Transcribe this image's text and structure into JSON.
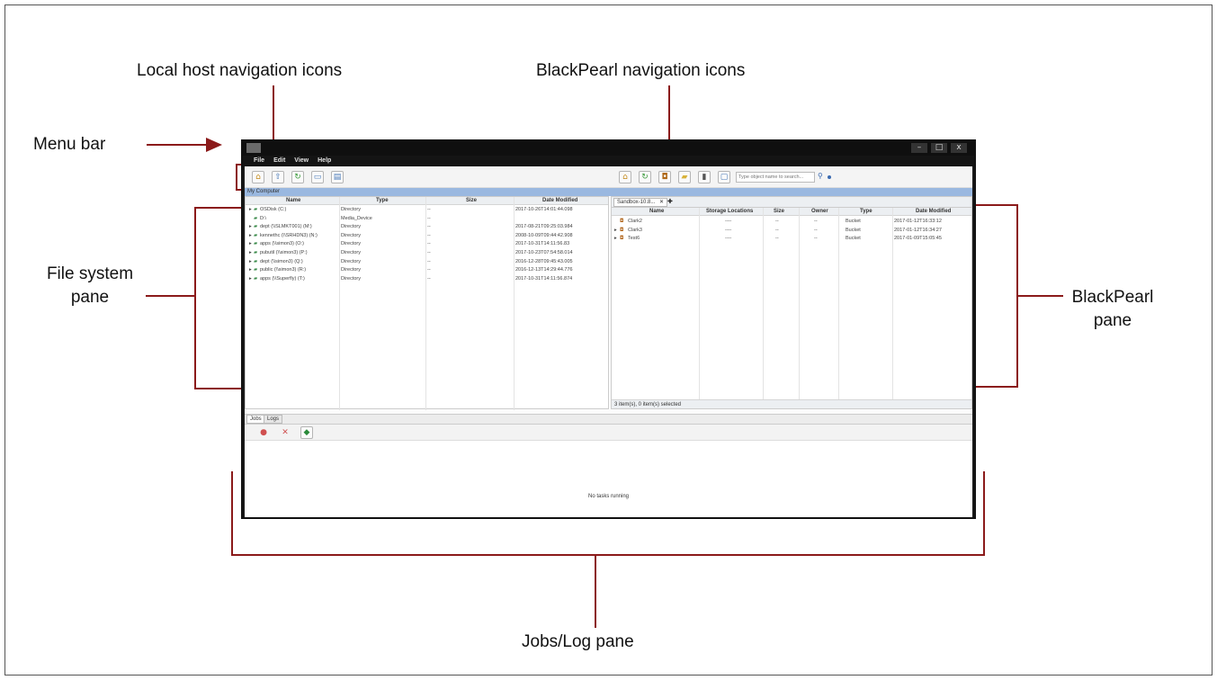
{
  "callouts": {
    "local_nav": "Local host navigation icons",
    "blackpearl_nav": "BlackPearl navigation icons",
    "menu_bar": "Menu bar",
    "file_system_pane_1": "File system",
    "file_system_pane_2": "pane",
    "blackpearl_pane_1": "BlackPearl",
    "blackpearl_pane_2": "pane",
    "jobs_log": "Jobs/Log pane"
  },
  "app": {
    "menu": [
      "File",
      "Edit",
      "View",
      "Help"
    ],
    "window_buttons": [
      "–",
      "□",
      "x"
    ],
    "local_toolbar_icons": [
      "home-icon",
      "parent-folder-icon",
      "refresh-icon",
      "computer-icon",
      "open-folder-icon"
    ],
    "bp_toolbar_icons": [
      "home-icon",
      "refresh-icon",
      "new-bucket-icon",
      "new-folder-icon",
      "books-icon",
      "folder-icon"
    ],
    "search_placeholder": "Type object name to search...",
    "search_icon": "magnifier-icon",
    "local_path": "My Computer",
    "local_columns": [
      "Name",
      "Type",
      "Size",
      "Date Modified"
    ],
    "local_rows": [
      {
        "expand": "▸",
        "name": "OSDisk (C:)",
        "type": "Directory",
        "size": "--",
        "date": "2017-10-26T14:01:44.098"
      },
      {
        "expand": "",
        "name": "D:\\",
        "type": "Media_Device",
        "size": "--",
        "date": ""
      },
      {
        "expand": "▸",
        "name": "dept (\\\\SLMKT001) (M:)",
        "type": "Directory",
        "size": "--",
        "date": "2017-08-21T09:25:03.984"
      },
      {
        "expand": "▸",
        "name": "kennethc (\\\\SRHDN3) (N:)",
        "type": "Directory",
        "size": "--",
        "date": "2008-10-09T09:44:42.908"
      },
      {
        "expand": "▸",
        "name": "apps (\\\\simon3) (O:)",
        "type": "Directory",
        "size": "--",
        "date": "2017-10-31T14:11:56.83"
      },
      {
        "expand": "▸",
        "name": "pubutil (\\\\simon3) (P:)",
        "type": "Directory",
        "size": "--",
        "date": "2017-10-23T07:54:58.014"
      },
      {
        "expand": "▸",
        "name": "dept (\\\\simon3) (Q:)",
        "type": "Directory",
        "size": "--",
        "date": "2016-12-28T09:45:43.005"
      },
      {
        "expand": "▸",
        "name": "public (\\\\simon3) (R:)",
        "type": "Directory",
        "size": "--",
        "date": "2016-12-13T14:29:44.776"
      },
      {
        "expand": "▸",
        "name": "apps (\\\\Superfly) (T:)",
        "type": "Directory",
        "size": "--",
        "date": "2017-10-31T14:11:56.874"
      }
    ],
    "bp_tab": "Sandbox-10.8...",
    "bp_tab_close": "✕",
    "bp_tab_add": "✚",
    "bp_columns": [
      "Name",
      "Storage Locations",
      "Size",
      "Owner",
      "Type",
      "Date Modified"
    ],
    "bp_rows": [
      {
        "expand": "",
        "name": "Clark2",
        "loc": "----",
        "size": "--",
        "owner": "--",
        "type": "Bucket",
        "date": "2017-01-12T16:33:12"
      },
      {
        "expand": "▸",
        "name": "Clark3",
        "loc": "----",
        "size": "--",
        "owner": "--",
        "type": "Bucket",
        "date": "2017-01-12T16:34:27"
      },
      {
        "expand": "▸",
        "name": "Test6",
        "loc": "----",
        "size": "--",
        "owner": "--",
        "type": "Bucket",
        "date": "2017-01-09T15:05:45"
      }
    ],
    "bp_status": "3 item(s), 0 item(s) selected",
    "jobs_tabs": [
      "Jobs",
      "Logs"
    ],
    "jobs_message": "No tasks running"
  },
  "colors": {
    "callout_line": "#8b1a1a",
    "titlebar": "#0f0f0f",
    "accent_blue": "#9ab8e0"
  }
}
